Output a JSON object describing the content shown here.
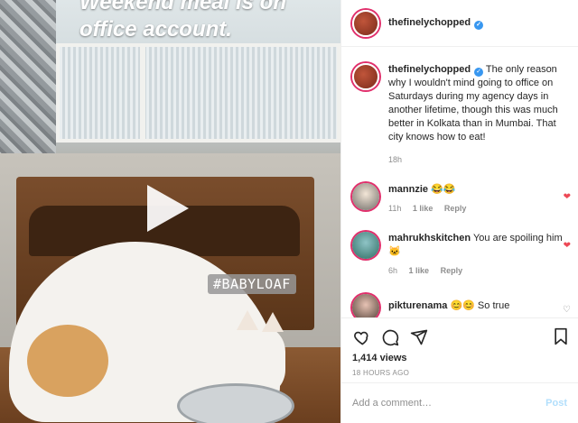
{
  "media": {
    "overlay_lines": [
      "Weekend meal is on",
      "office account."
    ],
    "tag_text": "#BABYLOAF"
  },
  "header": {
    "username": "thefinelychopped"
  },
  "caption": {
    "username": "thefinelychopped",
    "text": "The only reason why I wouldn't mind going to office on Saturdays during my agency days in another lifetime, though this was much better in Kolkata than in Mumbai. That city knows how to eat!",
    "time": "18h"
  },
  "comments": [
    {
      "username": "mannzie",
      "text": "😂😂",
      "time": "11h",
      "likes": "1 like",
      "reply": "Reply",
      "liked": true
    },
    {
      "username": "mahrukhskitchen",
      "text": "You are spoiling him🐱",
      "time": "6h",
      "likes": "1 like",
      "reply": "Reply",
      "liked": true
    },
    {
      "username": "pikturenama",
      "text": "😊😊 So true",
      "liked": false
    }
  ],
  "stats": {
    "views": "1,414 views",
    "posted": "18 HOURS AGO"
  },
  "add_comment": {
    "placeholder": "Add a comment…",
    "post_label": "Post"
  },
  "colors": {
    "verified": "#3897f0",
    "like_red": "#ed4956",
    "post_disabled": "#b2dffc",
    "muted": "#8e8e8e"
  }
}
